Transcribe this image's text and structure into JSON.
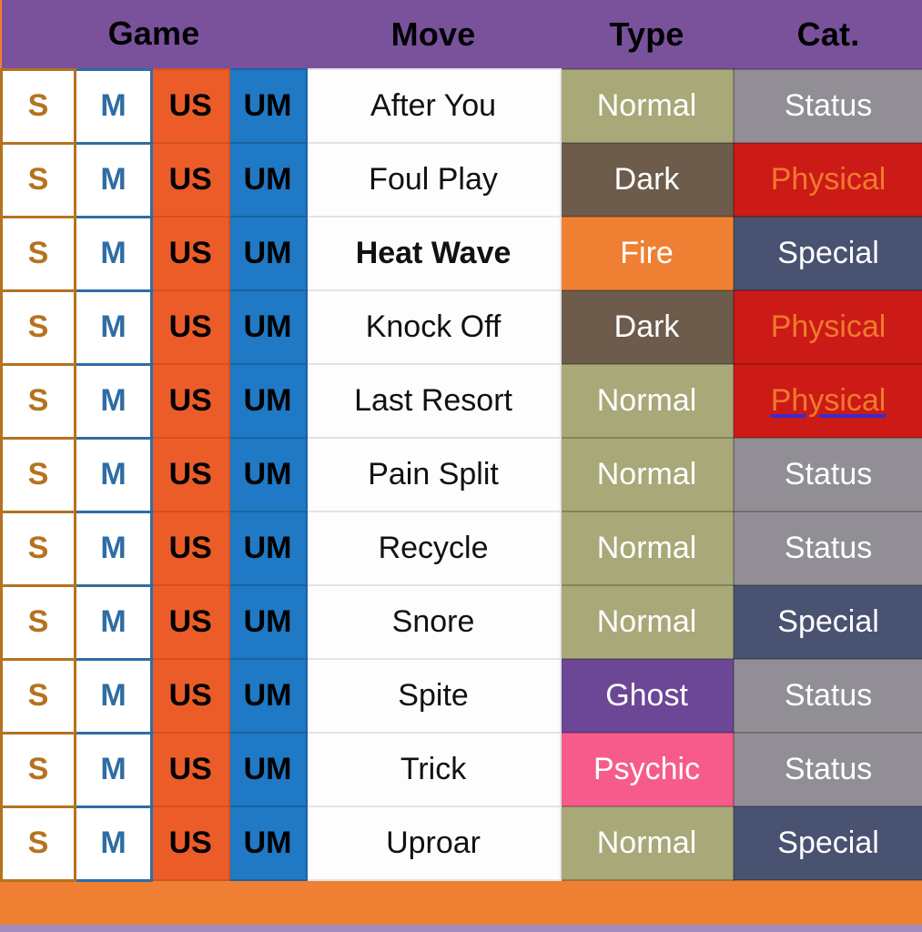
{
  "theme": {
    "header_bg": "#7a529c",
    "page_bg": "#ef8033",
    "bottom_strip": "#a38bbd",
    "s_text": "#b5721f",
    "m_text": "#2e6da4",
    "us_bg": "#ec5c29",
    "um_bg": "#1f79c4",
    "link_underline": "#3b2bcf"
  },
  "table": {
    "headers": {
      "game": "Game",
      "move": "Move",
      "type": "Type",
      "category": "Cat."
    },
    "game_labels": {
      "s": "S",
      "m": "M",
      "us": "US",
      "um": "UM"
    },
    "type_colors": {
      "Normal": "#a8a878",
      "Dark": "#6d5b4c",
      "Fire": "#ef8033",
      "Ghost": "#6b4796",
      "Psychic": "#f65b8c"
    },
    "category_colors": {
      "Status": "#918e95",
      "Physical": "#cc1a17",
      "Special": "#4a5272"
    },
    "category_text_colors": {
      "Status": "#ffffff",
      "Physical": "#f07a2d",
      "Special": "#ffffff"
    },
    "rows": [
      {
        "s": "S",
        "m": "M",
        "us": "US",
        "um": "UM",
        "move": "After You",
        "move_bold": false,
        "type": "Normal",
        "category": "Status",
        "category_linked": false
      },
      {
        "s": "S",
        "m": "M",
        "us": "US",
        "um": "UM",
        "move": "Foul Play",
        "move_bold": false,
        "type": "Dark",
        "category": "Physical",
        "category_linked": false
      },
      {
        "s": "S",
        "m": "M",
        "us": "US",
        "um": "UM",
        "move": "Heat Wave",
        "move_bold": true,
        "type": "Fire",
        "category": "Special",
        "category_linked": false
      },
      {
        "s": "S",
        "m": "M",
        "us": "US",
        "um": "UM",
        "move": "Knock Off",
        "move_bold": false,
        "type": "Dark",
        "category": "Physical",
        "category_linked": false
      },
      {
        "s": "S",
        "m": "M",
        "us": "US",
        "um": "UM",
        "move": "Last Resort",
        "move_bold": false,
        "type": "Normal",
        "category": "Physical",
        "category_linked": true
      },
      {
        "s": "S",
        "m": "M",
        "us": "US",
        "um": "UM",
        "move": "Pain Split",
        "move_bold": false,
        "type": "Normal",
        "category": "Status",
        "category_linked": false
      },
      {
        "s": "S",
        "m": "M",
        "us": "US",
        "um": "UM",
        "move": "Recycle",
        "move_bold": false,
        "type": "Normal",
        "category": "Status",
        "category_linked": false
      },
      {
        "s": "S",
        "m": "M",
        "us": "US",
        "um": "UM",
        "move": "Snore",
        "move_bold": false,
        "type": "Normal",
        "category": "Special",
        "category_linked": false
      },
      {
        "s": "S",
        "m": "M",
        "us": "US",
        "um": "UM",
        "move": "Spite",
        "move_bold": false,
        "type": "Ghost",
        "category": "Status",
        "category_linked": false
      },
      {
        "s": "S",
        "m": "M",
        "us": "US",
        "um": "UM",
        "move": "Trick",
        "move_bold": false,
        "type": "Psychic",
        "category": "Status",
        "category_linked": false
      },
      {
        "s": "S",
        "m": "M",
        "us": "US",
        "um": "UM",
        "move": "Uproar",
        "move_bold": false,
        "type": "Normal",
        "category": "Special",
        "category_linked": false
      }
    ]
  }
}
